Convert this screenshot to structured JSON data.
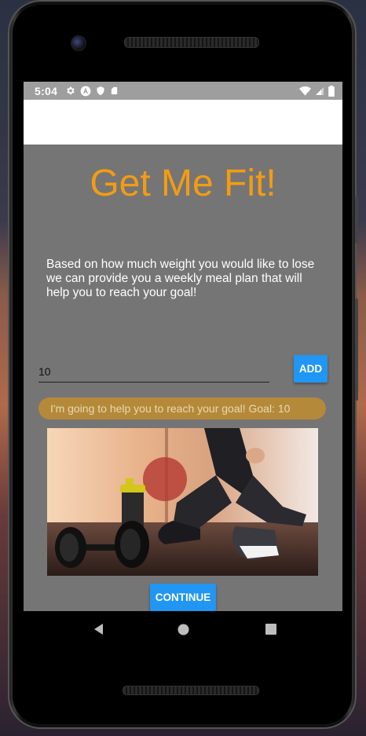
{
  "status_bar": {
    "time": "5:04",
    "left_icons": [
      "gear-icon",
      "font-icon",
      "shield-icon",
      "sd-card-icon"
    ],
    "right_icons": [
      "wifi-icon",
      "signal-icon",
      "battery-icon"
    ]
  },
  "app": {
    "title": "Get Me Fit!",
    "description": "Based on how much weight you would like to lose we can provide you a weekly meal plan that will help you to reach your goal!",
    "goal_input_value": "10",
    "add_label": "ADD",
    "goal_message": "I'm going to help you to reach your goal! Goal: 10",
    "hero_image": "fitness-photo",
    "continue_label": "CONTINUE"
  },
  "nav_bar": {
    "items": [
      "back-icon",
      "home-icon",
      "recents-icon"
    ]
  },
  "colors": {
    "title": "#f39c12",
    "button": "#2196f3",
    "content_bg": "#757575",
    "banner": "#b5893a"
  }
}
